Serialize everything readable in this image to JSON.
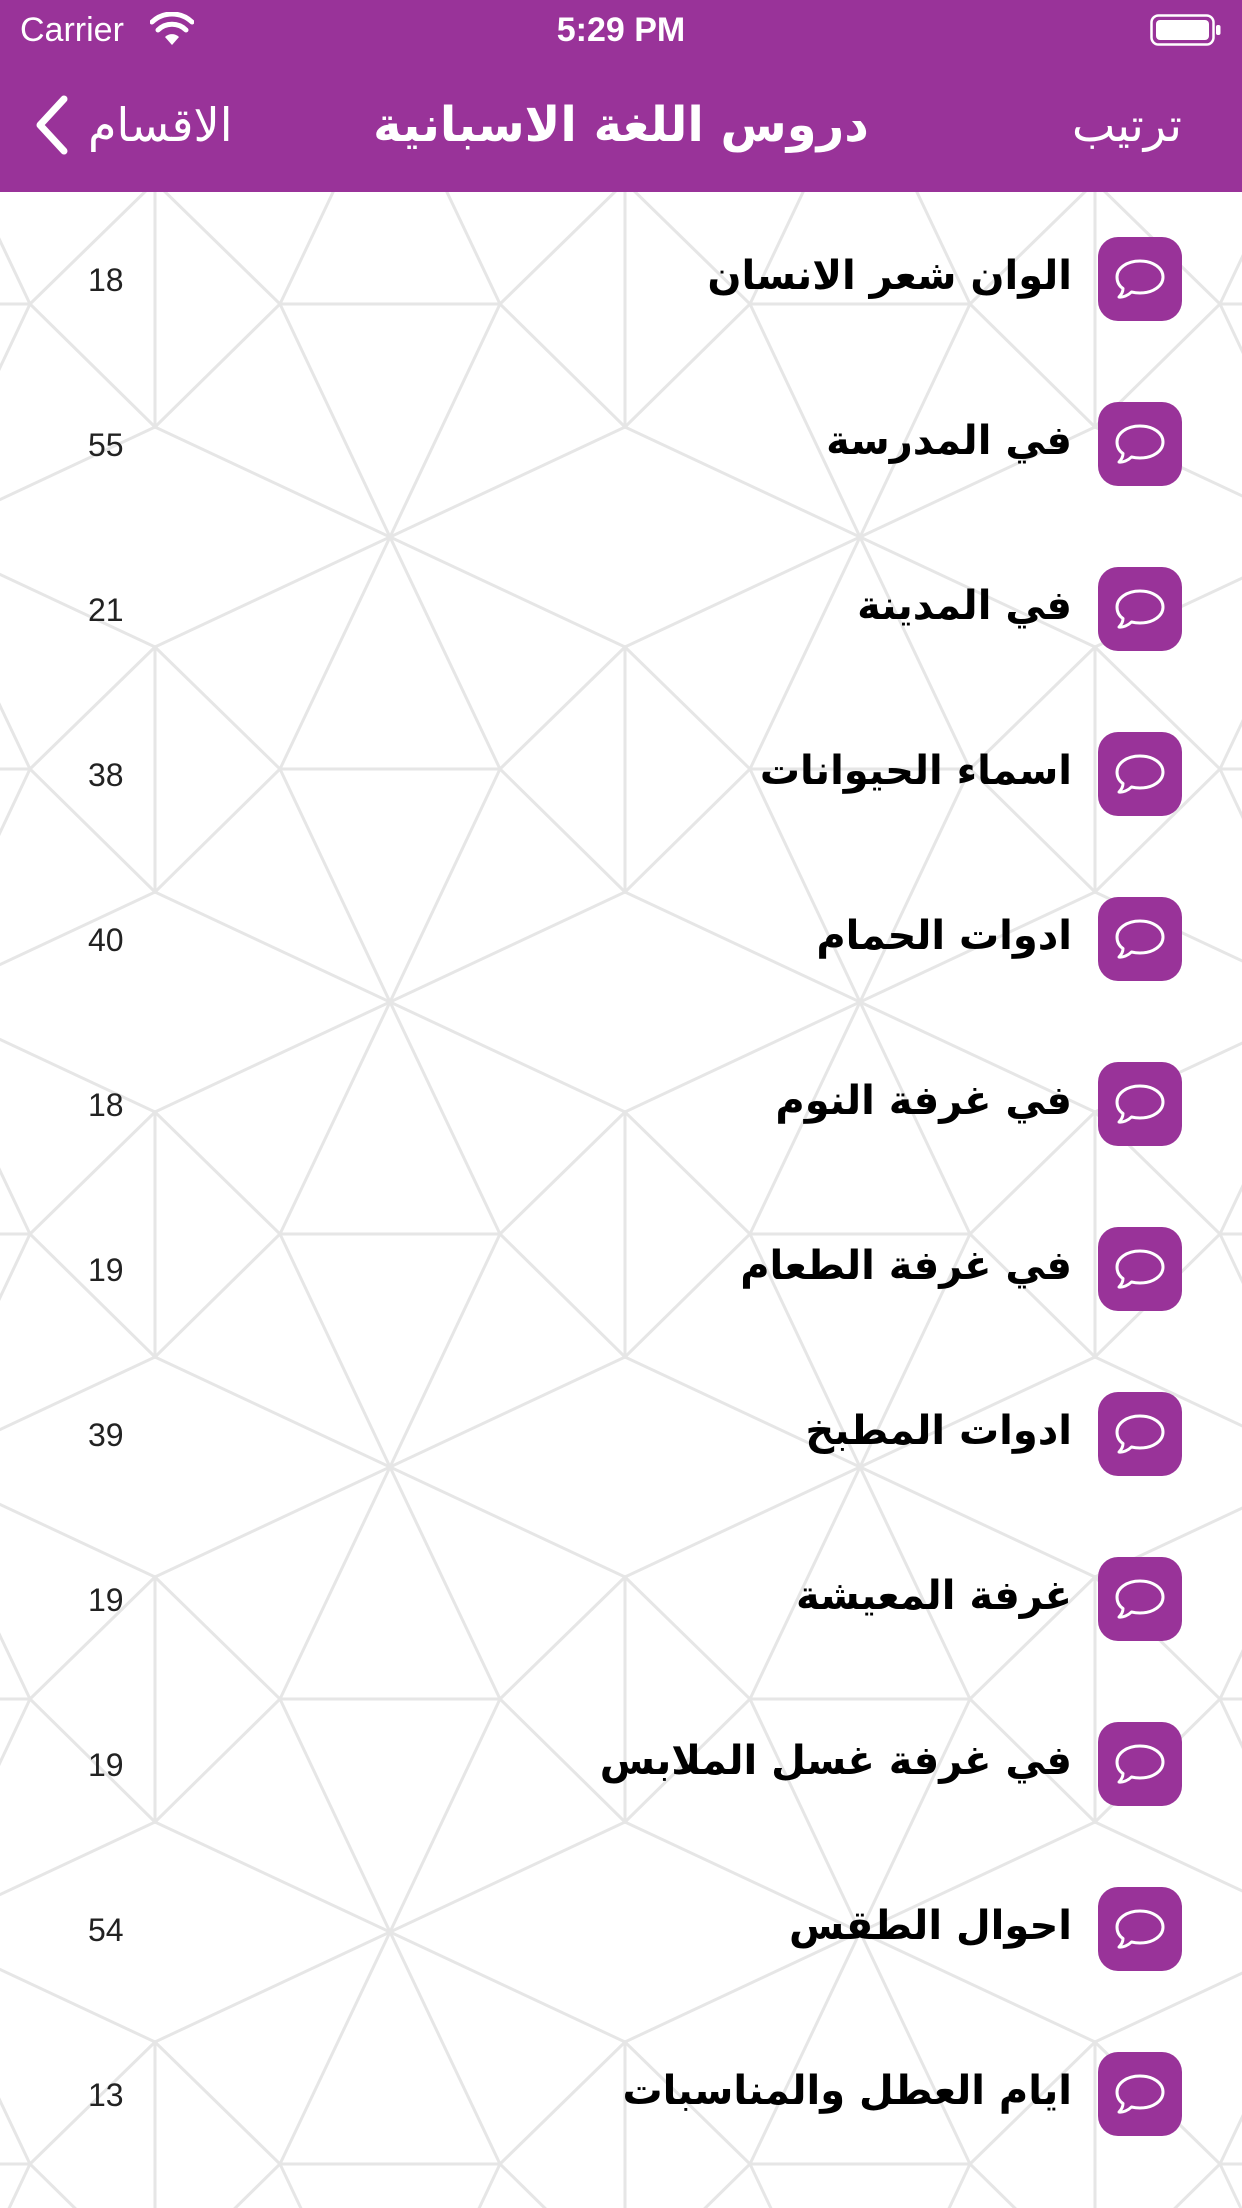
{
  "status_bar": {
    "carrier": "Carrier",
    "time": "5:29 PM",
    "wifi_icon": "wifi-icon",
    "battery_icon": "battery-icon"
  },
  "nav": {
    "back_label": "الاقسام",
    "back_icon": "chevron-left-icon",
    "title": "دروس اللغة الاسبانية",
    "sort_label": "ترتيب"
  },
  "colors": {
    "accent": "#993399",
    "background": "#ffffff",
    "pattern_lines": "#e6e6e6"
  },
  "lessons": [
    {
      "title": "الوان شعر الانسان",
      "count": "18",
      "icon": "speech-bubble-icon"
    },
    {
      "title": "في المدرسة",
      "count": "55",
      "icon": "speech-bubble-icon"
    },
    {
      "title": "في المدينة",
      "count": "21",
      "icon": "speech-bubble-icon"
    },
    {
      "title": "اسماء الحيوانات",
      "count": "38",
      "icon": "speech-bubble-icon"
    },
    {
      "title": "ادوات الحمام",
      "count": "40",
      "icon": "speech-bubble-icon"
    },
    {
      "title": "في غرفة النوم",
      "count": "18",
      "icon": "speech-bubble-icon"
    },
    {
      "title": "في غرفة الطعام",
      "count": "19",
      "icon": "speech-bubble-icon"
    },
    {
      "title": "ادوات المطبخ",
      "count": "39",
      "icon": "speech-bubble-icon"
    },
    {
      "title": "غرفة المعيشة",
      "count": "19",
      "icon": "speech-bubble-icon"
    },
    {
      "title": "في غرفة غسل الملابس",
      "count": "19",
      "icon": "speech-bubble-icon"
    },
    {
      "title": "احوال الطقس",
      "count": "54",
      "icon": "speech-bubble-icon"
    },
    {
      "title": "ايام العطل والمناسبات",
      "count": "13",
      "icon": "speech-bubble-icon"
    }
  ]
}
